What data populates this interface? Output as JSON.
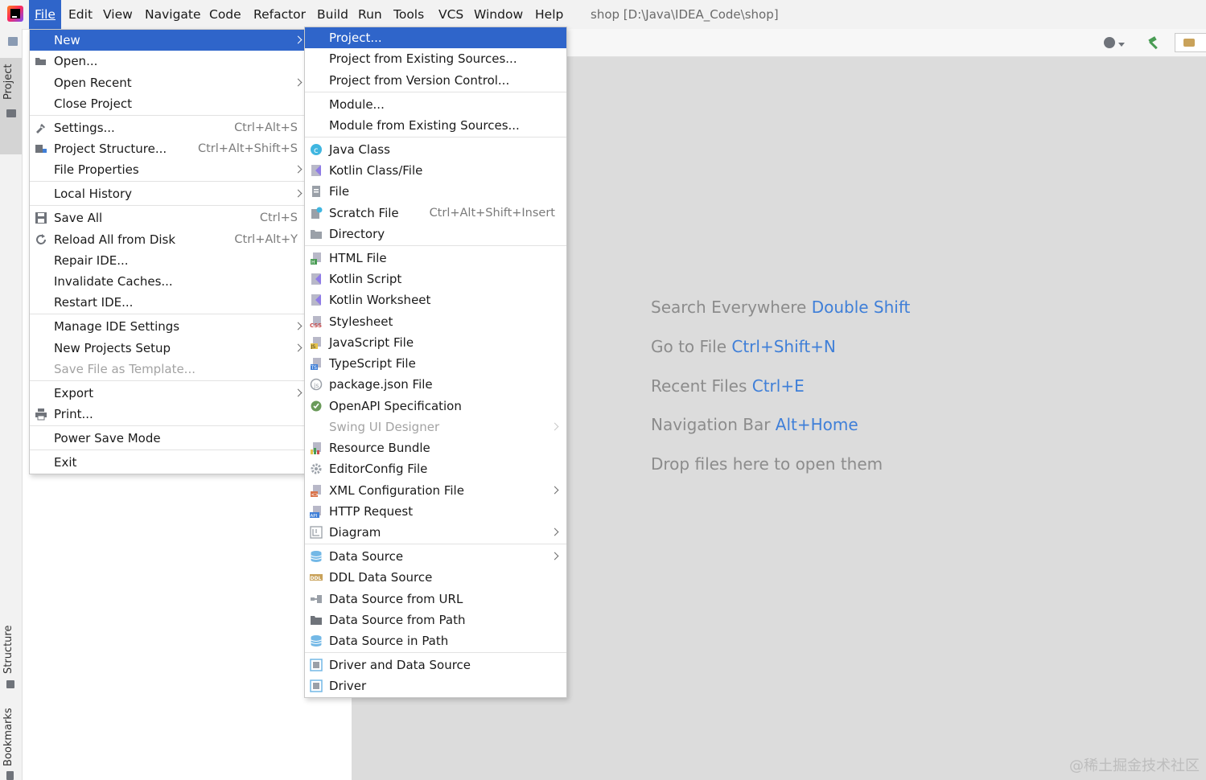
{
  "window_title": "shop [D:\\Java\\IDEA_Code\\shop]",
  "menubar": [
    "File",
    "Edit",
    "View",
    "Navigate",
    "Code",
    "Refactor",
    "Build",
    "Run",
    "Tools",
    "VCS",
    "Window",
    "Help"
  ],
  "tool_stripe": {
    "project": "Project",
    "structure": "Structure",
    "bookmarks": "Bookmarks"
  },
  "file_menu": [
    {
      "label": "New",
      "arrow": true,
      "selected": true
    },
    {
      "label": "Open..."
    },
    {
      "label": "Open Recent",
      "arrow": true
    },
    {
      "label": "Close Project"
    },
    {
      "label": "Settings...",
      "shortcut": "Ctrl+Alt+S"
    },
    {
      "label": "Project Structure...",
      "shortcut": "Ctrl+Alt+Shift+S"
    },
    {
      "label": "File Properties",
      "arrow": true
    },
    {
      "label": "Local History",
      "arrow": true
    },
    {
      "label": "Save All",
      "shortcut": "Ctrl+S"
    },
    {
      "label": "Reload All from Disk",
      "shortcut": "Ctrl+Alt+Y"
    },
    {
      "label": "Repair IDE..."
    },
    {
      "label": "Invalidate Caches..."
    },
    {
      "label": "Restart IDE..."
    },
    {
      "label": "Manage IDE Settings",
      "arrow": true
    },
    {
      "label": "New Projects Setup",
      "arrow": true
    },
    {
      "label": "Save File as Template...",
      "disabled": true
    },
    {
      "label": "Export",
      "arrow": true
    },
    {
      "label": "Print..."
    },
    {
      "label": "Power Save Mode"
    },
    {
      "label": "Exit"
    }
  ],
  "new_submenu": [
    {
      "label": "Project...",
      "selected": true
    },
    {
      "label": "Project from Existing Sources..."
    },
    {
      "label": "Project from Version Control..."
    },
    {
      "label": "Module..."
    },
    {
      "label": "Module from Existing Sources..."
    },
    {
      "label": "Java Class"
    },
    {
      "label": "Kotlin Class/File"
    },
    {
      "label": "File"
    },
    {
      "label": "Scratch File",
      "shortcut": "Ctrl+Alt+Shift+Insert"
    },
    {
      "label": "Directory"
    },
    {
      "label": "HTML File"
    },
    {
      "label": "Kotlin Script"
    },
    {
      "label": "Kotlin Worksheet"
    },
    {
      "label": "Stylesheet"
    },
    {
      "label": "JavaScript File"
    },
    {
      "label": "TypeScript File"
    },
    {
      "label": "package.json File"
    },
    {
      "label": "OpenAPI Specification"
    },
    {
      "label": "Swing UI Designer",
      "arrow": true,
      "disabled": true
    },
    {
      "label": "Resource Bundle"
    },
    {
      "label": "EditorConfig File"
    },
    {
      "label": "XML Configuration File",
      "arrow": true
    },
    {
      "label": "HTTP Request"
    },
    {
      "label": "Diagram",
      "arrow": true
    },
    {
      "label": "Data Source",
      "arrow": true
    },
    {
      "label": "DDL Data Source"
    },
    {
      "label": "Data Source from URL"
    },
    {
      "label": "Data Source from Path"
    },
    {
      "label": "Data Source in Path"
    },
    {
      "label": "Driver and Data Source"
    },
    {
      "label": "Driver"
    }
  ],
  "editor_hints": [
    {
      "text": "Search Everywhere",
      "key": "Double Shift"
    },
    {
      "text": "Go to File",
      "key": "Ctrl+Shift+N"
    },
    {
      "text": "Recent Files",
      "key": "Ctrl+E"
    },
    {
      "text": "Navigation Bar",
      "key": "Alt+Home"
    },
    {
      "text": "Drop files here to open them",
      "key": ""
    }
  ],
  "watermark": "@稀土掘金技术社区",
  "colors": {
    "selection": "#2f65ca",
    "hint_key": "#3f7fd8",
    "hint_text": "#8c8c8c"
  }
}
